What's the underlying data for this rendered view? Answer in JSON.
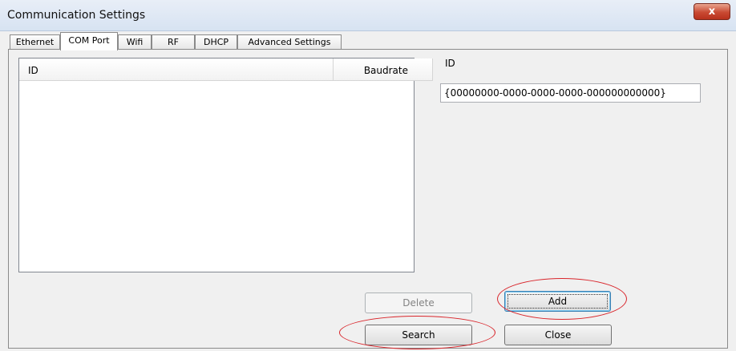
{
  "window": {
    "title": "Communication Settings",
    "close_glyph": "x"
  },
  "tabs": [
    {
      "label": "Ethernet"
    },
    {
      "label": "COM Port"
    },
    {
      "label": "Wifi"
    },
    {
      "label": "RF"
    },
    {
      "label": "DHCP"
    },
    {
      "label": "Advanced Settings"
    }
  ],
  "active_tab": "COM Port",
  "list": {
    "columns": [
      {
        "label": "ID"
      },
      {
        "label": "Baudrate"
      }
    ],
    "rows": []
  },
  "form": {
    "id_label": "ID",
    "id_value": "{00000000-0000-0000-0000-000000000000}"
  },
  "buttons": {
    "delete": "Delete",
    "add": "Add",
    "search": "Search",
    "close": "Close"
  },
  "colors": {
    "annotation": "#d9262c",
    "titlebar": "#d7e3f2",
    "close_button": "#c94a33"
  }
}
